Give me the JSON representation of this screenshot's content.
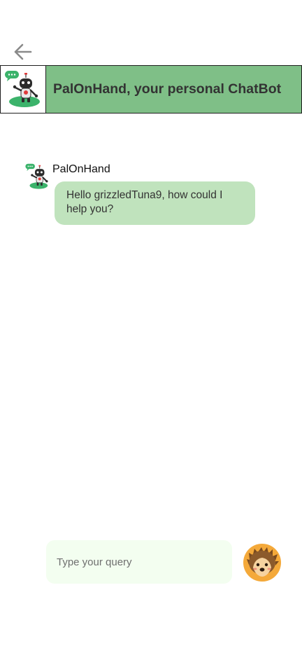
{
  "header": {
    "title": "PalOnHand, your personal ChatBot"
  },
  "icons": {
    "back": "back-arrow-icon",
    "bot": "robot-avatar-icon",
    "user": "hedgehog-avatar-icon"
  },
  "messages": [
    {
      "sender": "PalOnHand",
      "text": "Hello grizzledTuna9, how could I help you?"
    }
  ],
  "composer": {
    "placeholder": "Type your query",
    "value": ""
  },
  "colors": {
    "header_bg": "#7fbf87",
    "bubble_bg": "#c0e3bd",
    "input_bg": "#f3fef0",
    "back_arrow": "#8a8a8a",
    "avatar_orange": "#f4a93a"
  }
}
